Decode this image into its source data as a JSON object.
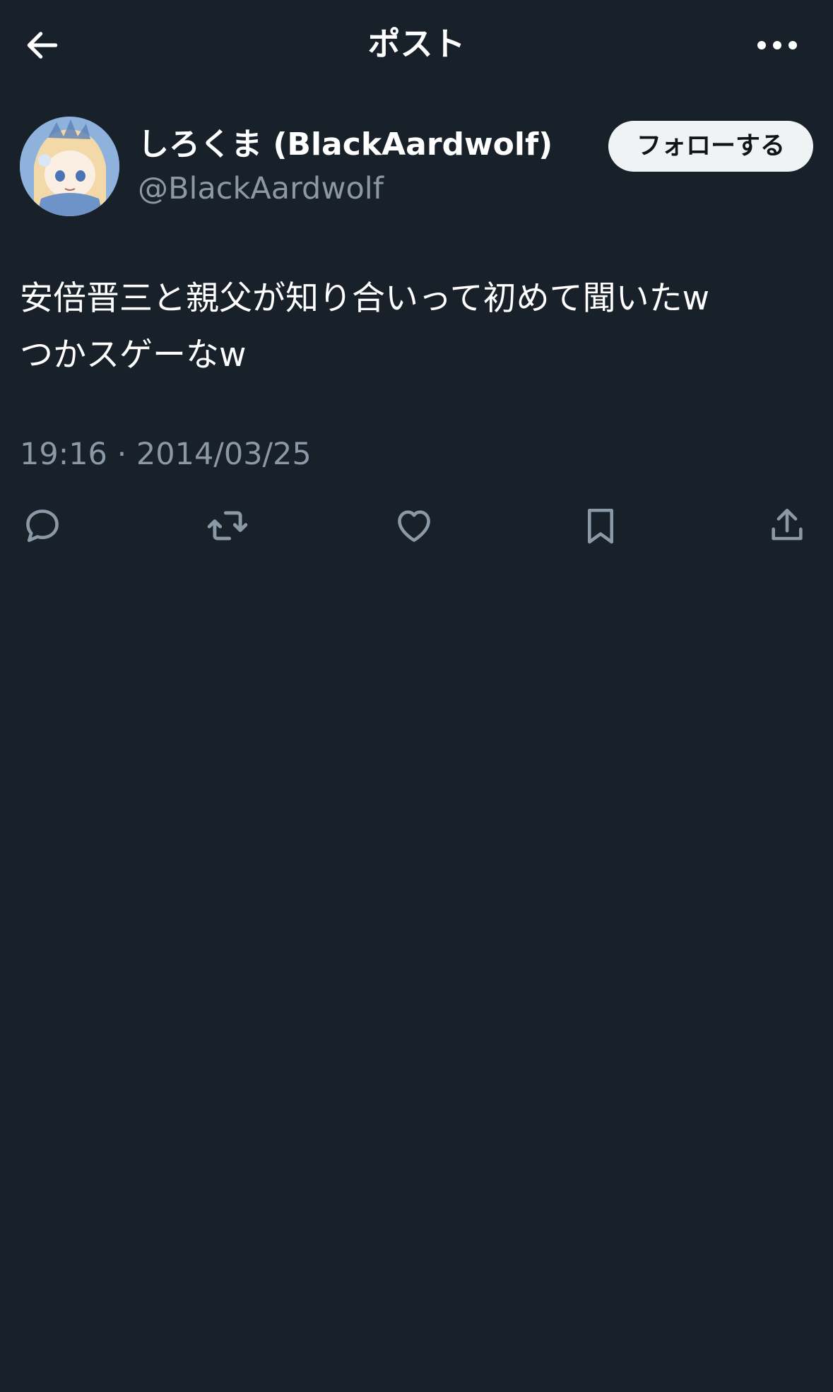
{
  "header": {
    "back_icon": "arrow-left-icon",
    "title": "ポスト",
    "more_icon": "more-horizontal-icon"
  },
  "author": {
    "display_name": "しろくま (BlackAardwolf)",
    "handle": "@BlackAardwolf",
    "follow_label": "フォローする"
  },
  "post": {
    "lines": [
      "安倍晋三と親父が知り合いって初めて聞いたw",
      "つかスゲーなw"
    ],
    "timestamp": "19:16 · 2014/03/25"
  },
  "actions": {
    "reply_icon": "reply-icon",
    "repost_icon": "repost-icon",
    "like_icon": "heart-icon",
    "bookmark_icon": "bookmark-icon",
    "share_icon": "share-icon"
  },
  "colors": {
    "background": "#18202a",
    "text": "#ffffff",
    "secondary_text": "#8b98a5",
    "follow_button_bg": "#eff3f4"
  }
}
